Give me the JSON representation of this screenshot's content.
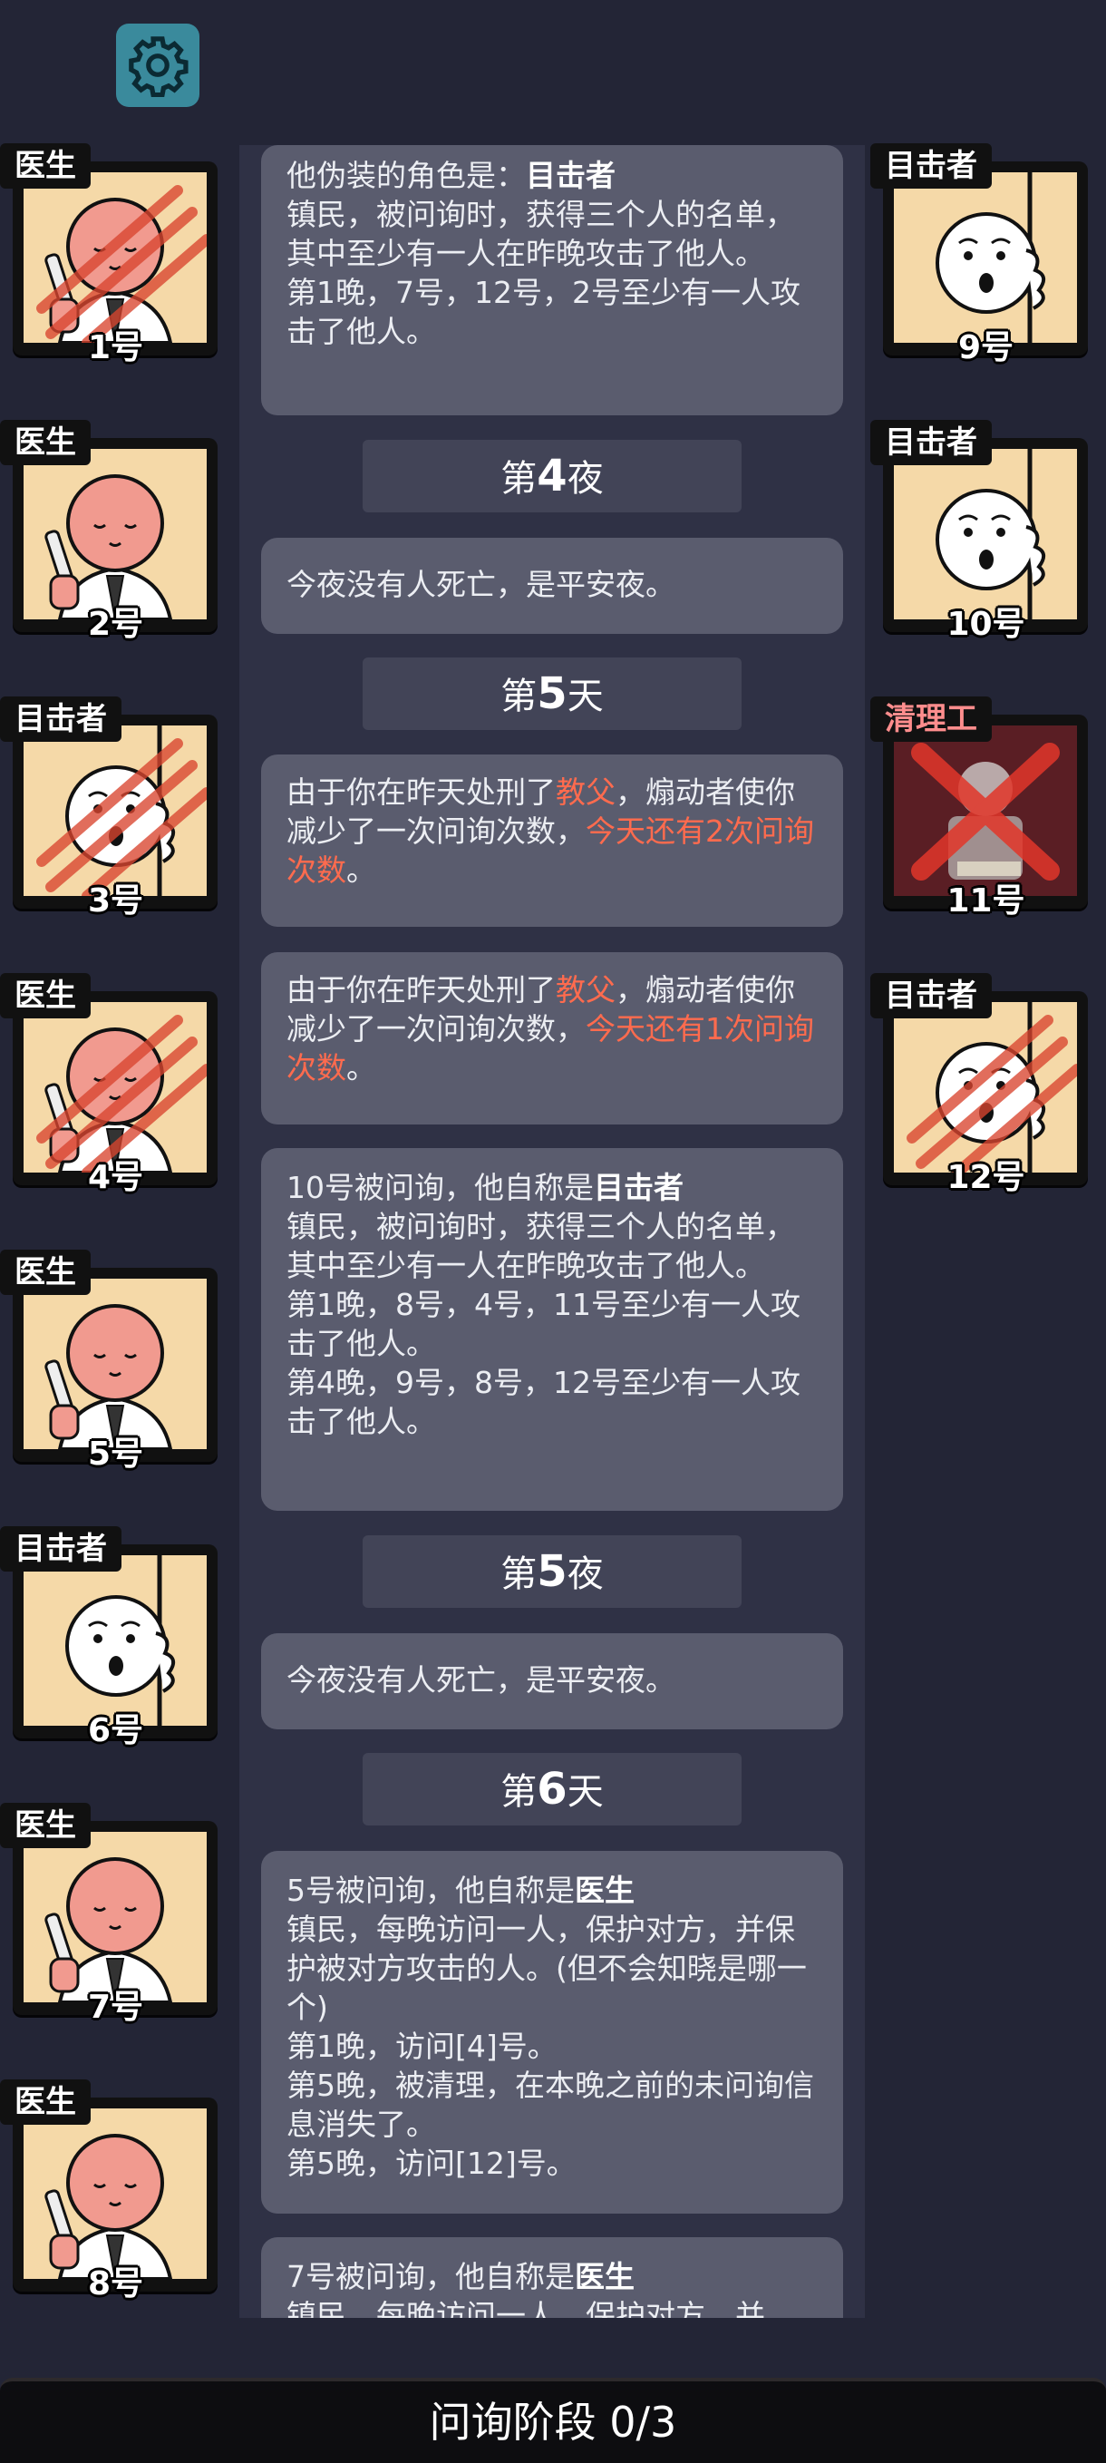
{
  "settings_icon": "gear-icon",
  "left_players": [
    {
      "role": "医生",
      "num": "1号",
      "art": "doctor",
      "state": "attacked"
    },
    {
      "role": "医生",
      "num": "2号",
      "art": "doctor",
      "state": "alive"
    },
    {
      "role": "目击者",
      "num": "3号",
      "art": "witness",
      "state": "attacked"
    },
    {
      "role": "医生",
      "num": "4号",
      "art": "doctor",
      "state": "attacked"
    },
    {
      "role": "医生",
      "num": "5号",
      "art": "doctor",
      "state": "alive"
    },
    {
      "role": "目击者",
      "num": "6号",
      "art": "witness",
      "state": "alive"
    },
    {
      "role": "医生",
      "num": "7号",
      "art": "doctor",
      "state": "alive"
    },
    {
      "role": "医生",
      "num": "8号",
      "art": "doctor",
      "state": "alive"
    }
  ],
  "right_players": [
    {
      "role": "目击者",
      "num": "9号",
      "art": "witness",
      "state": "alive"
    },
    {
      "role": "目击者",
      "num": "10号",
      "art": "witness",
      "state": "alive"
    },
    {
      "role": "清理工",
      "num": "11号",
      "art": "cleaner",
      "state": "executed"
    },
    {
      "role": "目击者",
      "num": "12号",
      "art": "witness",
      "state": "attacked"
    }
  ],
  "log": {
    "m1": {
      "line1_pre": "他伪装的角色是：",
      "line1_role": "目击者",
      "body": "镇民，被问询时，获得三个人的名单，其中至少有一人在昨晚攻击了他人。",
      "night": "第1晚，7号，12号，2号至少有一人攻击了他人。"
    },
    "p1": {
      "pre": "第",
      "n": "4",
      "post": "夜"
    },
    "m2": {
      "text": "今夜没有人死亡，是平安夜。"
    },
    "p2": {
      "pre": "第",
      "n": "5",
      "post": "天"
    },
    "m3": {
      "a": "由于你在昨天处刑了",
      "b": "教父",
      "c": "，煽动者使你减少了一次问询次数，",
      "d": "今天还有2次问询次数",
      "e": "。"
    },
    "m4": {
      "a": "由于你在昨天处刑了",
      "b": "教父",
      "c": "，煽动者使你减少了一次问询次数，",
      "d": "今天还有1次问询次数",
      "e": "。"
    },
    "m5": {
      "pre": "10号被问询，他自称是",
      "role": "目击者",
      "body": "镇民，被问询时，获得三个人的名单，其中至少有一人在昨晚攻击了他人。",
      "n1": "第1晚，8号，4号，11号至少有一人攻击了他人。",
      "n2": "第4晚，9号，8号，12号至少有一人攻击了他人。"
    },
    "p3": {
      "pre": "第",
      "n": "5",
      "post": "夜"
    },
    "m6": {
      "text": "今夜没有人死亡，是平安夜。"
    },
    "p4": {
      "pre": "第",
      "n": "6",
      "post": "天"
    },
    "m7": {
      "pre": "5号被问询，他自称是",
      "role": "医生",
      "body": "镇民，每晚访问一人，保护对方，并保护被对方攻击的人。(但不会知晓是哪一个)",
      "l1": "第1晚，访问[4]号。",
      "l2": "第5晚，被清理，在本晚之前的未问询信息消失了。",
      "l3": "第5晚，访问[12]号。"
    },
    "m8": {
      "pre": "7号被问询，他自称是",
      "role": "医生",
      "body": "镇民，每晚访问一人，保护对方，并"
    }
  },
  "bottom_bar": {
    "label": "问询阶段 0/3"
  }
}
